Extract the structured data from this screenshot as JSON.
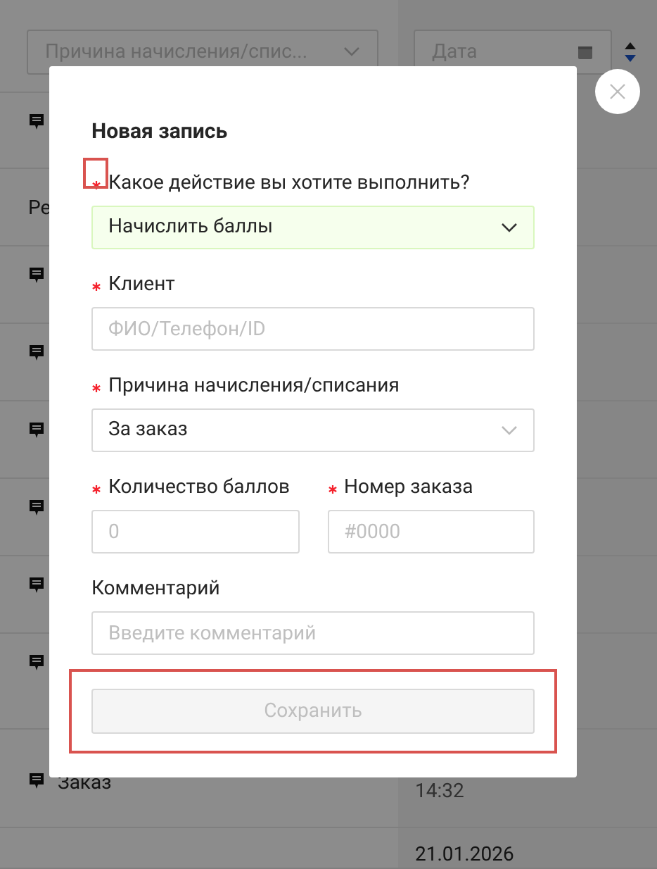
{
  "background": {
    "filter_select": {
      "placeholder": "Причина начисления/спис..."
    },
    "date_field": {
      "placeholder": "Дата"
    },
    "rows": [
      {
        "comment": true
      },
      {
        "comment": false,
        "text": "Ре"
      },
      {
        "comment": true
      },
      {
        "comment": true
      },
      {
        "comment": true
      },
      {
        "comment": true
      },
      {
        "comment": true
      },
      {
        "comment": true
      },
      {
        "comment": true,
        "text": "Заказ",
        "time": "14:32"
      },
      {
        "comment": false,
        "date": "21.01.2026"
      }
    ]
  },
  "modal": {
    "title": "Новая запись",
    "fields": [
      {
        "kind": "select",
        "label": "Какое действие вы хотите выполнить?",
        "required": true,
        "mark_highlighted": true,
        "value": "Начислить баллы",
        "valid": true
      },
      {
        "kind": "input",
        "label": "Клиент",
        "required": true,
        "placeholder": "ФИО/Телефон/ID"
      },
      {
        "kind": "select",
        "label": "Причина начисления/списания",
        "required": true,
        "value": "За заказ",
        "valid": false
      },
      {
        "kind": "pair",
        "fields": [
          {
            "kind": "input",
            "label": "Количество баллов",
            "required": true,
            "placeholder": "0"
          },
          {
            "kind": "input",
            "label": "Номер заказа",
            "required": true,
            "placeholder": "#0000"
          }
        ]
      },
      {
        "kind": "input",
        "label": "Комментарий",
        "required": false,
        "placeholder": "Введите комментарий"
      }
    ],
    "save_button": {
      "label": "Сохранить",
      "disabled": true,
      "highlighted": true
    }
  }
}
